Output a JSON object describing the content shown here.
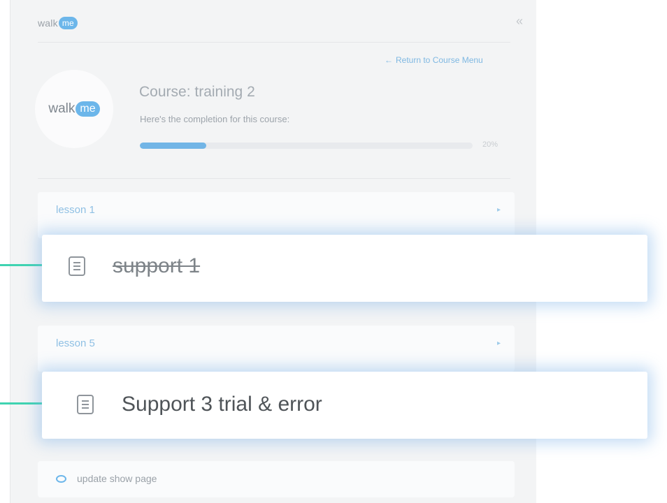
{
  "header": {
    "brand_walk": "walk",
    "brand_me": "me",
    "collapse_glyph": "«",
    "return_link": "Return to Course Menu",
    "return_arrow": "←"
  },
  "course": {
    "logo_walk": "walk",
    "logo_me": "me",
    "title": "Course: training 2",
    "completion_label": "Here's the completion for this course:",
    "progress_percent": 20,
    "progress_text": "20%"
  },
  "lessons": [
    {
      "label": "lesson 1",
      "chevron": "▸",
      "item": {
        "title": "support 1",
        "completed": true
      }
    },
    {
      "label": "lesson 5",
      "chevron": "▸",
      "item": {
        "title": "Support 3 trial & error",
        "completed": false
      }
    }
  ],
  "footer_item": {
    "label": "update show page"
  },
  "colors": {
    "accent_blue": "#72b5e6",
    "connector_green": "#3fd3b1",
    "glow": "#78afe6"
  }
}
